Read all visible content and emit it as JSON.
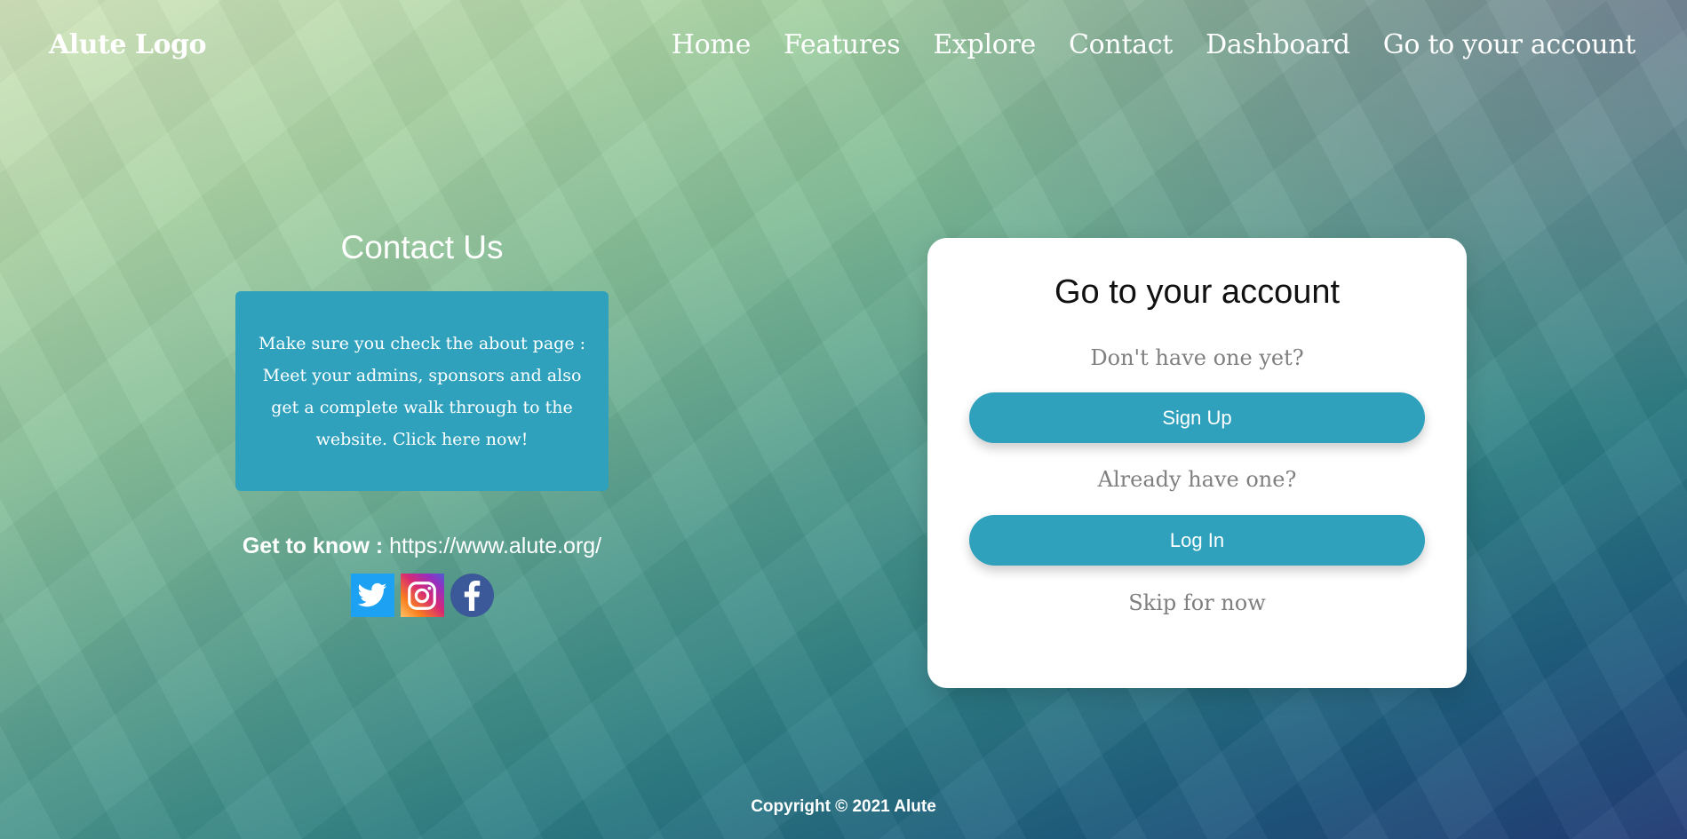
{
  "header": {
    "logo": "Alute Logo",
    "nav": [
      "Home",
      "Features",
      "Explore",
      "Contact",
      "Dashboard",
      "Go to your account"
    ]
  },
  "contact": {
    "title": "Contact Us",
    "notice": "Make sure you check the about page : Meet your admins, sponsors and also get a complete walk through to the website. Click here now!",
    "know_label": "Get to know :",
    "know_url": "https://www.alute.org/",
    "social_icons": [
      "twitter-icon",
      "instagram-icon",
      "facebook-icon"
    ]
  },
  "account": {
    "title": "Go to your account",
    "signup_hint": "Don't have one yet?",
    "signup_button": "Sign Up",
    "login_hint": "Already have one?",
    "login_button": "Log In",
    "skip": "Skip for now"
  },
  "footer": {
    "copyright": "Copyright © 2021 Alute"
  },
  "colors": {
    "accent": "#2fa1bd",
    "card_bg": "#ffffff",
    "hint_text": "#7f7f7f"
  }
}
